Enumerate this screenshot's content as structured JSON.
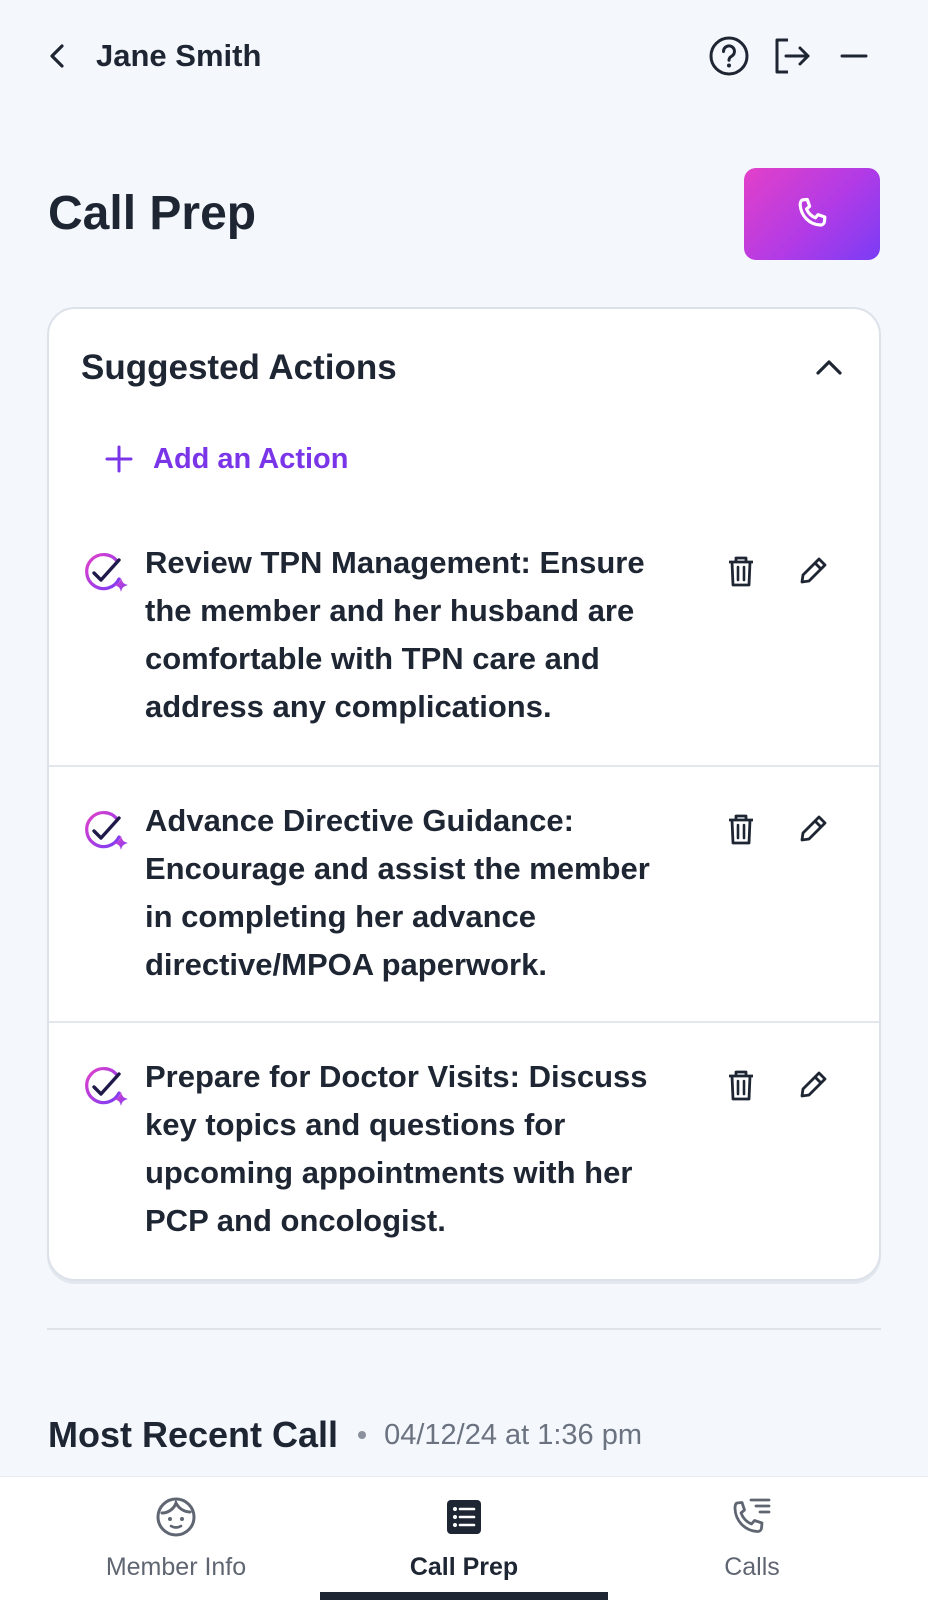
{
  "header": {
    "member_name": "Jane Smith",
    "icons": [
      "chevron-left-icon",
      "help-circle-icon",
      "logout-icon",
      "minimize-icon"
    ]
  },
  "page": {
    "title": "Call Prep",
    "call_button_icon": "phone-icon"
  },
  "suggested_actions": {
    "title": "Suggested Actions",
    "add_action_label": "Add an Action",
    "items": [
      {
        "text": "Review TPN Management: Ensure the member and her husband are comfortable with TPN care and address any complications."
      },
      {
        "text": "Advance Directive Guidance: Encourage and assist the member in completing her advance directive/MPOA paperwork."
      },
      {
        "text": "Prepare for Doctor Visits: Discuss key topics and questions for upcoming appointments with her PCP and oncologist."
      }
    ]
  },
  "most_recent_call": {
    "title": "Most Recent Call",
    "date": "04/12/24 at 1:36 pm"
  },
  "bottom_nav": {
    "tabs": [
      {
        "label": "Member Info",
        "icon": "member-face-icon",
        "active": false
      },
      {
        "label": "Call Prep",
        "icon": "checklist-icon",
        "active": true
      },
      {
        "label": "Calls",
        "icon": "phone-list-icon",
        "active": false
      }
    ]
  },
  "colors": {
    "accent_purple": "#7b35e8",
    "call_gradient_start": "#e240c8",
    "call_gradient_end": "#7a3cf5",
    "text_dark": "#1f2633",
    "background": "#f4f7fc"
  }
}
